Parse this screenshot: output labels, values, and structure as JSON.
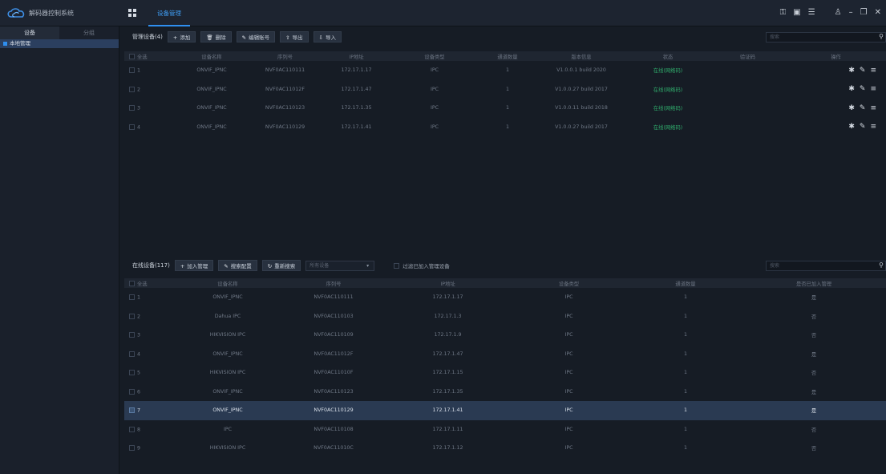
{
  "app": {
    "title": "解码器控制系统",
    "main_tab": "设备管理"
  },
  "titlebar_icons": [
    "lock-icon",
    "monitor-icon",
    "list-icon",
    "user-icon",
    "minimize-icon",
    "restore-icon",
    "close-icon"
  ],
  "sidebar": {
    "tabs": [
      "设备",
      "分组"
    ],
    "items": [
      {
        "label": "本地管理"
      }
    ]
  },
  "managed": {
    "title": "管理设备(4)",
    "buttons": {
      "add": "添加",
      "delete": "删除",
      "edit_account": "编辑账号",
      "export": "导出",
      "import": "导入"
    },
    "search_placeholder": "搜索",
    "columns": [
      "全选",
      "设备名称",
      "序列号",
      "IP地址",
      "设备类型",
      "通道数量",
      "版本信息",
      "状态",
      "验证码",
      "操作"
    ],
    "rows": [
      {
        "no": "1",
        "name": "ONVIF_IPNC",
        "serial": "NVF0AC110111",
        "ip": "172.17.1.17",
        "type": "IPC",
        "channels": "1",
        "version": "V1.0.0.1 build 2020",
        "status": "在线(网络码)",
        "code": ""
      },
      {
        "no": "2",
        "name": "ONVIF_IPNC",
        "serial": "NVF0AC11012F",
        "ip": "172.17.1.47",
        "type": "IPC",
        "channels": "1",
        "version": "V1.0.0.27 build 2017",
        "status": "在线(网络码)",
        "code": ""
      },
      {
        "no": "3",
        "name": "ONVIF_IPNC",
        "serial": "NVF0AC110123",
        "ip": "172.17.1.35",
        "type": "IPC",
        "channels": "1",
        "version": "V1.0.0.11 build 2018",
        "status": "在线(网络码)",
        "code": ""
      },
      {
        "no": "4",
        "name": "ONVIF_IPNC",
        "serial": "NVF0AC110129",
        "ip": "172.17.1.41",
        "type": "IPC",
        "channels": "1",
        "version": "V1.0.0.27 build 2017",
        "status": "在线(网络码)",
        "code": ""
      }
    ]
  },
  "online": {
    "title": "在线设备(117)",
    "buttons": {
      "add_manage": "加入管理",
      "search_config": "搜索配置",
      "research": "重新搜索"
    },
    "dropdown_value": "所有设备",
    "filter_label": "过滤已加入管理设备",
    "search_placeholder": "搜索",
    "columns": [
      "全选",
      "设备名称",
      "序列号",
      "IP地址",
      "设备类型",
      "通道数量",
      "是否已加入管理"
    ],
    "rows": [
      {
        "no": "1",
        "name": "ONVIF_IPNC",
        "serial": "NVF0AC110111",
        "ip": "172.17.1.17",
        "type": "IPC",
        "channels": "1",
        "managed": "是"
      },
      {
        "no": "2",
        "name": "Dahua IPC",
        "serial": "NVF0AC110103",
        "ip": "172.17.1.3",
        "type": "IPC",
        "channels": "1",
        "managed": "否"
      },
      {
        "no": "3",
        "name": "HIKVISION IPC",
        "serial": "NVF0AC110109",
        "ip": "172.17.1.9",
        "type": "IPC",
        "channels": "1",
        "managed": "否"
      },
      {
        "no": "4",
        "name": "ONVIF_IPNC",
        "serial": "NVF0AC11012F",
        "ip": "172.17.1.47",
        "type": "IPC",
        "channels": "1",
        "managed": "是"
      },
      {
        "no": "5",
        "name": "HIKVISION IPC",
        "serial": "NVF0AC11010F",
        "ip": "172.17.1.15",
        "type": "IPC",
        "channels": "1",
        "managed": "否"
      },
      {
        "no": "6",
        "name": "ONVIF_IPNC",
        "serial": "NVF0AC110123",
        "ip": "172.17.1.35",
        "type": "IPC",
        "channels": "1",
        "managed": "是"
      },
      {
        "no": "7",
        "name": "ONVIF_IPNC",
        "serial": "NVF0AC110129",
        "ip": "172.17.1.41",
        "type": "IPC",
        "channels": "1",
        "managed": "是"
      },
      {
        "no": "8",
        "name": "IPC",
        "serial": "NVF0AC110108",
        "ip": "172.17.1.11",
        "type": "IPC",
        "channels": "1",
        "managed": "否"
      },
      {
        "no": "9",
        "name": "HIKVISION IPC",
        "serial": "NVF0AC11010C",
        "ip": "172.17.1.12",
        "type": "IPC",
        "channels": "1",
        "managed": "否"
      }
    ],
    "selected_row": "7"
  },
  "colors": {
    "accent": "#2f8ff0",
    "status_online": "#2fa86a",
    "selected_row": "#2a3a52"
  }
}
